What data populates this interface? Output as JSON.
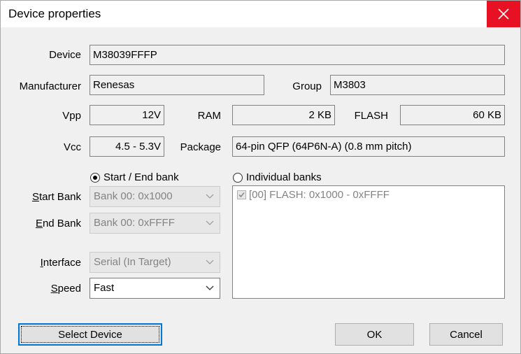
{
  "window": {
    "title": "Device properties"
  },
  "labels": {
    "device": "Device",
    "manufacturer": "Manufacturer",
    "group": "Group",
    "vpp": "Vpp",
    "ram": "RAM",
    "flash": "FLASH",
    "vcc": "Vcc",
    "package": "Package",
    "start_bank": "Start Bank",
    "end_bank": "End Bank",
    "interface": "Interface",
    "speed": "Speed"
  },
  "values": {
    "device": "M38039FFFP",
    "manufacturer": "Renesas",
    "group": "M3803",
    "vpp": "12V",
    "ram": "2 KB",
    "flash": "60 KB",
    "vcc": "4.5 - 5.3V",
    "package": "64-pin QFP (64P6N-A) (0.8 mm pitch)"
  },
  "bank_mode": {
    "start_end_label": "Start / End bank",
    "individual_label": "Individual banks",
    "selected": "start_end"
  },
  "combos": {
    "start_bank": "Bank 00: 0x1000",
    "end_bank": "Bank 00: 0xFFFF",
    "interface": "Serial (In Target)",
    "speed": "Fast"
  },
  "banks": [
    {
      "label": "[00] FLASH: 0x1000 - 0xFFFF",
      "checked": true
    }
  ],
  "buttons": {
    "select_device": "Select Device",
    "ok": "OK",
    "cancel": "Cancel"
  },
  "colors": {
    "close_button": "#e81123",
    "focus_border": "#0078d7"
  }
}
